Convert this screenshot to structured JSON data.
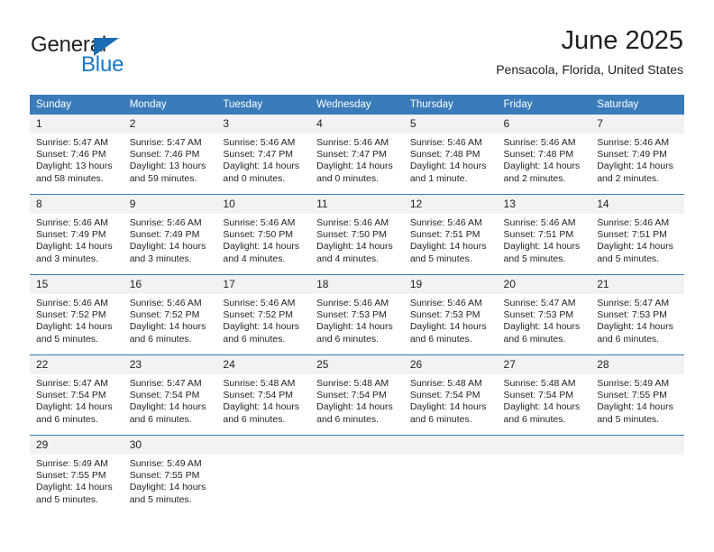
{
  "logo": {
    "word1": "General",
    "word2": "Blue",
    "triangle_color": "#1a6cb5",
    "word2_color": "#1878c8"
  },
  "header": {
    "title": "June 2025",
    "subtitle": "Pensacola, Florida, United States"
  },
  "theme": {
    "header_row_bg": "#3a7cba",
    "header_row_text": "#ffffff",
    "daynum_bg": "#f2f2f2",
    "row_divider": "#3a7cba",
    "body_text": "#231f20"
  },
  "weekday_headers": [
    "Sunday",
    "Monday",
    "Tuesday",
    "Wednesday",
    "Thursday",
    "Friday",
    "Saturday"
  ],
  "labels": {
    "sunrise_prefix": "Sunrise:",
    "sunset_prefix": "Sunset:",
    "daylight_prefix": "Daylight:"
  },
  "weeks": [
    [
      {
        "day": "1",
        "sunrise": "Sunrise: 5:47 AM",
        "sunset": "Sunset: 7:46 PM",
        "daylight1": "Daylight: 13 hours",
        "daylight2": "and 58 minutes."
      },
      {
        "day": "2",
        "sunrise": "Sunrise: 5:47 AM",
        "sunset": "Sunset: 7:46 PM",
        "daylight1": "Daylight: 13 hours",
        "daylight2": "and 59 minutes."
      },
      {
        "day": "3",
        "sunrise": "Sunrise: 5:46 AM",
        "sunset": "Sunset: 7:47 PM",
        "daylight1": "Daylight: 14 hours",
        "daylight2": "and 0 minutes."
      },
      {
        "day": "4",
        "sunrise": "Sunrise: 5:46 AM",
        "sunset": "Sunset: 7:47 PM",
        "daylight1": "Daylight: 14 hours",
        "daylight2": "and 0 minutes."
      },
      {
        "day": "5",
        "sunrise": "Sunrise: 5:46 AM",
        "sunset": "Sunset: 7:48 PM",
        "daylight1": "Daylight: 14 hours",
        "daylight2": "and 1 minute."
      },
      {
        "day": "6",
        "sunrise": "Sunrise: 5:46 AM",
        "sunset": "Sunset: 7:48 PM",
        "daylight1": "Daylight: 14 hours",
        "daylight2": "and 2 minutes."
      },
      {
        "day": "7",
        "sunrise": "Sunrise: 5:46 AM",
        "sunset": "Sunset: 7:49 PM",
        "daylight1": "Daylight: 14 hours",
        "daylight2": "and 2 minutes."
      }
    ],
    [
      {
        "day": "8",
        "sunrise": "Sunrise: 5:46 AM",
        "sunset": "Sunset: 7:49 PM",
        "daylight1": "Daylight: 14 hours",
        "daylight2": "and 3 minutes."
      },
      {
        "day": "9",
        "sunrise": "Sunrise: 5:46 AM",
        "sunset": "Sunset: 7:49 PM",
        "daylight1": "Daylight: 14 hours",
        "daylight2": "and 3 minutes."
      },
      {
        "day": "10",
        "sunrise": "Sunrise: 5:46 AM",
        "sunset": "Sunset: 7:50 PM",
        "daylight1": "Daylight: 14 hours",
        "daylight2": "and 4 minutes."
      },
      {
        "day": "11",
        "sunrise": "Sunrise: 5:46 AM",
        "sunset": "Sunset: 7:50 PM",
        "daylight1": "Daylight: 14 hours",
        "daylight2": "and 4 minutes."
      },
      {
        "day": "12",
        "sunrise": "Sunrise: 5:46 AM",
        "sunset": "Sunset: 7:51 PM",
        "daylight1": "Daylight: 14 hours",
        "daylight2": "and 5 minutes."
      },
      {
        "day": "13",
        "sunrise": "Sunrise: 5:46 AM",
        "sunset": "Sunset: 7:51 PM",
        "daylight1": "Daylight: 14 hours",
        "daylight2": "and 5 minutes."
      },
      {
        "day": "14",
        "sunrise": "Sunrise: 5:46 AM",
        "sunset": "Sunset: 7:51 PM",
        "daylight1": "Daylight: 14 hours",
        "daylight2": "and 5 minutes."
      }
    ],
    [
      {
        "day": "15",
        "sunrise": "Sunrise: 5:46 AM",
        "sunset": "Sunset: 7:52 PM",
        "daylight1": "Daylight: 14 hours",
        "daylight2": "and 5 minutes."
      },
      {
        "day": "16",
        "sunrise": "Sunrise: 5:46 AM",
        "sunset": "Sunset: 7:52 PM",
        "daylight1": "Daylight: 14 hours",
        "daylight2": "and 6 minutes."
      },
      {
        "day": "17",
        "sunrise": "Sunrise: 5:46 AM",
        "sunset": "Sunset: 7:52 PM",
        "daylight1": "Daylight: 14 hours",
        "daylight2": "and 6 minutes."
      },
      {
        "day": "18",
        "sunrise": "Sunrise: 5:46 AM",
        "sunset": "Sunset: 7:53 PM",
        "daylight1": "Daylight: 14 hours",
        "daylight2": "and 6 minutes."
      },
      {
        "day": "19",
        "sunrise": "Sunrise: 5:46 AM",
        "sunset": "Sunset: 7:53 PM",
        "daylight1": "Daylight: 14 hours",
        "daylight2": "and 6 minutes."
      },
      {
        "day": "20",
        "sunrise": "Sunrise: 5:47 AM",
        "sunset": "Sunset: 7:53 PM",
        "daylight1": "Daylight: 14 hours",
        "daylight2": "and 6 minutes."
      },
      {
        "day": "21",
        "sunrise": "Sunrise: 5:47 AM",
        "sunset": "Sunset: 7:53 PM",
        "daylight1": "Daylight: 14 hours",
        "daylight2": "and 6 minutes."
      }
    ],
    [
      {
        "day": "22",
        "sunrise": "Sunrise: 5:47 AM",
        "sunset": "Sunset: 7:54 PM",
        "daylight1": "Daylight: 14 hours",
        "daylight2": "and 6 minutes."
      },
      {
        "day": "23",
        "sunrise": "Sunrise: 5:47 AM",
        "sunset": "Sunset: 7:54 PM",
        "daylight1": "Daylight: 14 hours",
        "daylight2": "and 6 minutes."
      },
      {
        "day": "24",
        "sunrise": "Sunrise: 5:48 AM",
        "sunset": "Sunset: 7:54 PM",
        "daylight1": "Daylight: 14 hours",
        "daylight2": "and 6 minutes."
      },
      {
        "day": "25",
        "sunrise": "Sunrise: 5:48 AM",
        "sunset": "Sunset: 7:54 PM",
        "daylight1": "Daylight: 14 hours",
        "daylight2": "and 6 minutes."
      },
      {
        "day": "26",
        "sunrise": "Sunrise: 5:48 AM",
        "sunset": "Sunset: 7:54 PM",
        "daylight1": "Daylight: 14 hours",
        "daylight2": "and 6 minutes."
      },
      {
        "day": "27",
        "sunrise": "Sunrise: 5:48 AM",
        "sunset": "Sunset: 7:54 PM",
        "daylight1": "Daylight: 14 hours",
        "daylight2": "and 6 minutes."
      },
      {
        "day": "28",
        "sunrise": "Sunrise: 5:49 AM",
        "sunset": "Sunset: 7:55 PM",
        "daylight1": "Daylight: 14 hours",
        "daylight2": "and 5 minutes."
      }
    ],
    [
      {
        "day": "29",
        "sunrise": "Sunrise: 5:49 AM",
        "sunset": "Sunset: 7:55 PM",
        "daylight1": "Daylight: 14 hours",
        "daylight2": "and 5 minutes."
      },
      {
        "day": "30",
        "sunrise": "Sunrise: 5:49 AM",
        "sunset": "Sunset: 7:55 PM",
        "daylight1": "Daylight: 14 hours",
        "daylight2": "and 5 minutes."
      },
      {
        "day": "",
        "sunrise": "",
        "sunset": "",
        "daylight1": "",
        "daylight2": ""
      },
      {
        "day": "",
        "sunrise": "",
        "sunset": "",
        "daylight1": "",
        "daylight2": ""
      },
      {
        "day": "",
        "sunrise": "",
        "sunset": "",
        "daylight1": "",
        "daylight2": ""
      },
      {
        "day": "",
        "sunrise": "",
        "sunset": "",
        "daylight1": "",
        "daylight2": ""
      },
      {
        "day": "",
        "sunrise": "",
        "sunset": "",
        "daylight1": "",
        "daylight2": ""
      }
    ]
  ]
}
